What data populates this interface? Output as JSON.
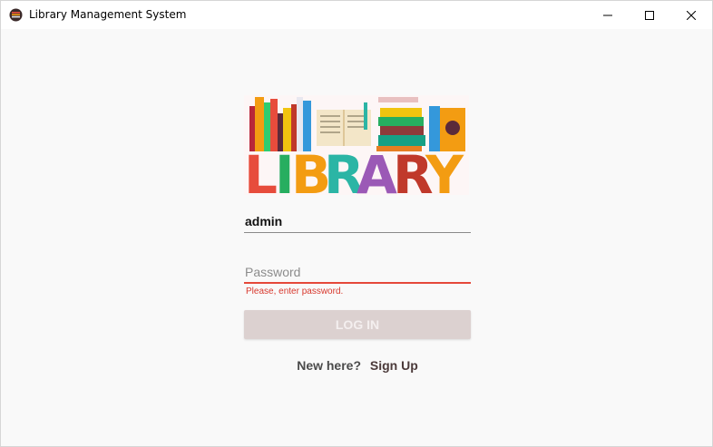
{
  "window": {
    "title": "Library Management System",
    "controls": {
      "minimize": "minimize-icon",
      "maximize": "maximize-icon",
      "close": "close-icon"
    }
  },
  "logo": {
    "text": "LIBRARY"
  },
  "form": {
    "username_value": "admin",
    "password_placeholder": "Password",
    "password_error": "Please, enter password.",
    "login_label": "LOG IN"
  },
  "signup": {
    "prompt": "New here?",
    "link_label": "Sign Up"
  },
  "colors": {
    "error": "#e5483a",
    "button_disabled": "#dcd1d0",
    "background": "#f9f9f9"
  }
}
